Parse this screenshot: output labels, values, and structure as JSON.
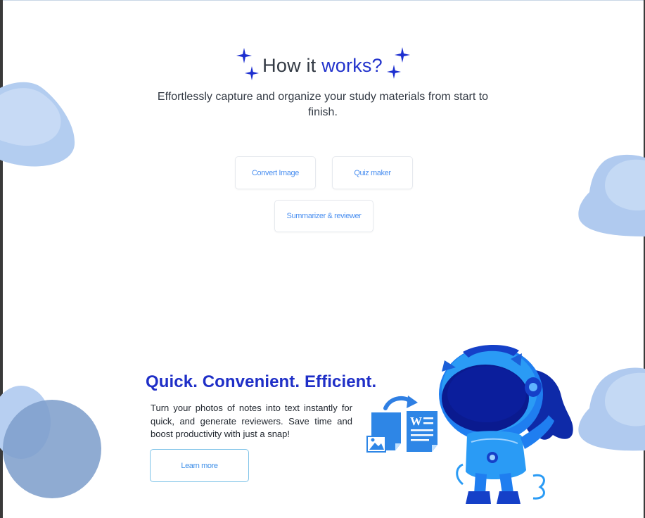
{
  "how_it_works": {
    "title_plain": "How it ",
    "title_accent": "works?",
    "subtitle": "Effortlessly capture and organize your study materials from start to finish.",
    "tabs": [
      "Convert Image",
      "Quiz maker",
      "Summarizer & reviewer"
    ]
  },
  "feature": {
    "headline": "Quick. Convenient. Efficient.",
    "description": "Turn your photos of notes into text instantly for quick, and generate reviewers. Save time and boost productivity with just a snap!",
    "cta_label": "Learn more"
  },
  "colors": {
    "accent": "#2233cc",
    "tab_text": "#4a8ff0",
    "blob": "#a9c6ec",
    "headline": "#1f2fc7"
  },
  "icons": [
    "sparkle-icon",
    "image-file-icon",
    "word-document-icon",
    "convert-arrow-icon",
    "astronaut-mascot"
  ]
}
